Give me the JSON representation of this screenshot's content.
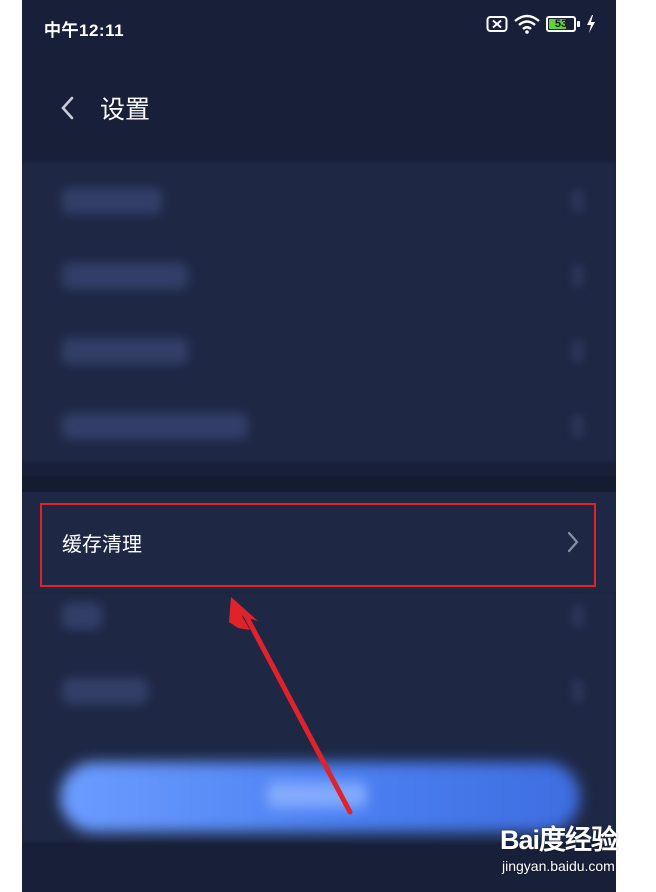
{
  "status_bar": {
    "time": "中午12:11",
    "battery": "53"
  },
  "header": {
    "title": "设置"
  },
  "cache_row": {
    "label": "缓存清理"
  },
  "watermark": {
    "brand": "Bai度经验",
    "url": "jingyan.baidu.com"
  },
  "colors": {
    "background": "#172038",
    "row_bg": "#1e2845",
    "highlight": "#e0222b",
    "button": "#4a7ef0",
    "battery": "#62d13a"
  }
}
